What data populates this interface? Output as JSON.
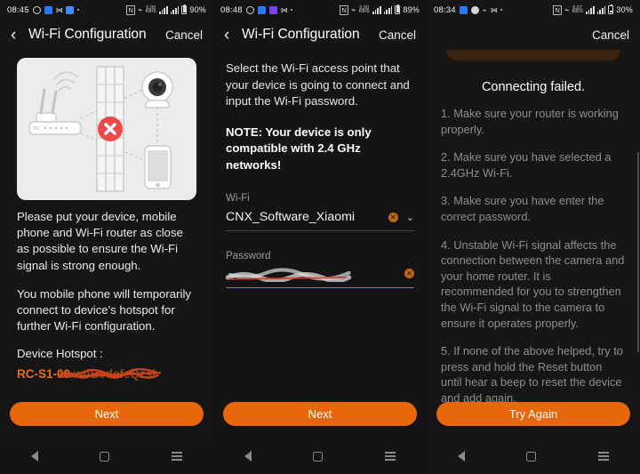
{
  "accent_color": "#e8670c",
  "panels": [
    {
      "statusbar": {
        "time": "08:45",
        "left_icons": [
          "circle-check-icon",
          "alarm-icon",
          "message-icon",
          "mail-icon",
          "dot-icon"
        ],
        "right_icons": [
          "nfc-icon",
          "bluetooth-icon",
          "data-rate-icon",
          "signal-bars-icon",
          "signal-bars-2-icon",
          "battery-icon"
        ],
        "battery_percent": "90%"
      },
      "appbar": {
        "back": "‹",
        "title": "Wi-Fi Configuration",
        "cancel": "Cancel"
      },
      "illustration": {
        "name": "router-wall-camera-phone-illustration",
        "elements": [
          "wifi-router-icon",
          "brick-wall-icon",
          "red-x-blocked-icon",
          "ip-camera-icon",
          "smartphone-icon"
        ]
      },
      "paragraphs": [
        "Please put your device, mobile phone and Wi-Fi router as close as possible to ensure the Wi-Fi signal is strong enough.",
        "You mobile phone will temporarily connect to device's hotspot for further Wi-Fi configuration."
      ],
      "hotspot_label": "Device Hotspot :",
      "hotspot_value": "RC-S1-00",
      "cta": "Next",
      "navbar": [
        "back-nav-icon",
        "home-nav-icon",
        "menu-nav-icon"
      ]
    },
    {
      "statusbar": {
        "time": "08:48",
        "left_icons": [
          "circle-check-icon",
          "alarm-icon",
          "purple-app-icon",
          "message-icon",
          "dot-icon"
        ],
        "right_icons": [
          "nfc-icon",
          "bluetooth-icon",
          "data-rate-icon",
          "signal-bars-icon",
          "signal-bars-2-icon",
          "battery-icon"
        ],
        "battery_percent": "89%"
      },
      "appbar": {
        "back": "‹",
        "title": "Wi-Fi Configuration",
        "cancel": "Cancel"
      },
      "intro": "Select the Wi-Fi access point that your device is going to connect and input the Wi-Fi password.",
      "note": "NOTE: Your device is only compatible with 2.4 GHz networks!",
      "wifi_field": {
        "label": "Wi-Fi",
        "value": "CNX_Software_Xiaomi",
        "clear_icon": "clear-x-icon",
        "dropdown_icon": "chevron-down-icon"
      },
      "password_field": {
        "label": "Password",
        "value": "",
        "clear_icon": "clear-x-icon",
        "redacted": true
      },
      "cta": "Next",
      "navbar": [
        "back-nav-icon",
        "home-nav-icon",
        "menu-nav-icon"
      ]
    },
    {
      "statusbar": {
        "time": "08:34",
        "left_icons": [
          "alarm-icon",
          "circle-app-icon",
          "bluetooth-small-icon",
          "message-icon",
          "dot-icon"
        ],
        "right_icons": [
          "nfc-icon",
          "bluetooth-icon",
          "data-rate-icon",
          "signal-bars-icon",
          "signal-bars-2-icon",
          "battery-icon"
        ],
        "battery_percent": "30%"
      },
      "appbar": {
        "back": "",
        "title": "",
        "cancel": "Cancel"
      },
      "fail_title": "Connecting failed.",
      "steps": [
        "1. Make sure your router is working properly.",
        "2. Make sure you have selected a 2.4GHz Wi-Fi.",
        "3. Make sure you have enter the correct password.",
        "4. Unstable Wi-Fi signal affects the connection between the camera and your home router. It is recommended for you to strengthen the Wi-Fi signal to the camera to ensure it operates properly.",
        "5. If none of the above helped, try to press and hold the Reset button until hear a beep to reset the device and add again."
      ],
      "cta": "Try Again",
      "navbar": [
        "back-nav-icon",
        "home-nav-icon",
        "menu-nav-icon"
      ]
    }
  ]
}
